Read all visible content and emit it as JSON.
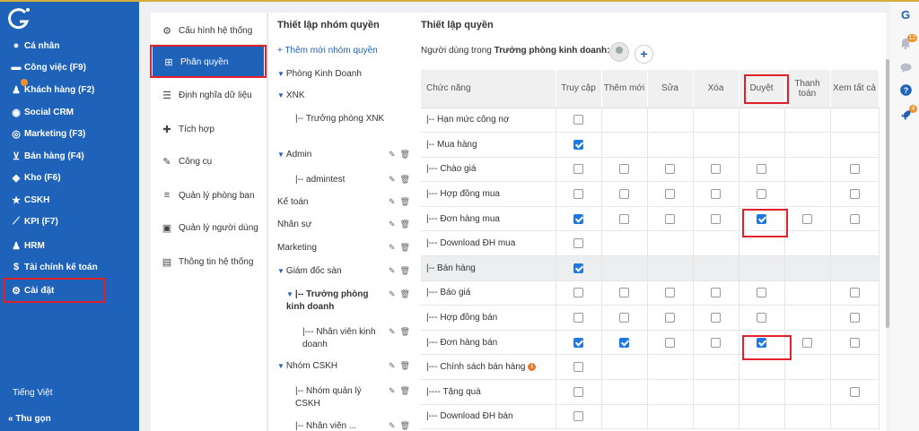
{
  "sidebar": {
    "logo": "G",
    "items": [
      {
        "icon": "user-icon",
        "label": "Cá nhân"
      },
      {
        "icon": "briefcase-icon",
        "label": "Công việc (F9)"
      },
      {
        "icon": "customers-icon",
        "label": "Khách hàng (F2)",
        "badge": true
      },
      {
        "icon": "eye-icon",
        "label": "Social CRM"
      },
      {
        "icon": "bullseye-icon",
        "label": "Marketing (F3)"
      },
      {
        "icon": "cart-icon",
        "label": "Bán hàng (F4)"
      },
      {
        "icon": "cubes-icon",
        "label": "Kho (F6)"
      },
      {
        "icon": "star-icon",
        "label": "CSKH"
      },
      {
        "icon": "chart-line-icon",
        "label": "KPI (F7)"
      },
      {
        "icon": "users-icon",
        "label": "HRM"
      },
      {
        "icon": "dollar-icon",
        "label": "Tài chính kế toán"
      },
      {
        "icon": "gear-icon",
        "label": "Cài đặt"
      }
    ],
    "language": "Tiếng Việt",
    "collapse": "Thu gọn"
  },
  "settings_menu": [
    {
      "icon": "cogs-icon",
      "label": "Cấu hình hệ thống"
    },
    {
      "icon": "sitemap-icon",
      "label": "Phân quyền",
      "active": true
    },
    {
      "icon": "list-icon",
      "label": "Định nghĩa dữ liệu"
    },
    {
      "icon": "puzzle-icon",
      "label": "Tích hợp"
    },
    {
      "icon": "wrench-icon",
      "label": "Công cụ"
    },
    {
      "icon": "sliders-icon",
      "label": "Quản lý phòng ban"
    },
    {
      "icon": "user-book-icon",
      "label": "Quản lý người dùng"
    },
    {
      "icon": "server-icon",
      "label": "Thông tin hệ thống"
    }
  ],
  "groups": {
    "title": "Thiết lập nhóm quyền",
    "add_label": "+ Thêm mới nhóm quyền",
    "items": [
      {
        "label": "Phòng Kinh Doanh",
        "tri": true,
        "actions": false
      },
      {
        "label": "XNK",
        "tri": true,
        "actions": false
      },
      {
        "label": "|-- Trưởng phòng XNK",
        "tri": false,
        "actions": false
      },
      {
        "label": "Admin",
        "tri": true,
        "actions": true
      },
      {
        "label": "|-- admintest",
        "tri": false,
        "actions": true
      },
      {
        "label": "Kế toán",
        "tri": false,
        "actions": true
      },
      {
        "label": "Nhân sự",
        "tri": false,
        "actions": true
      },
      {
        "label": "Marketing",
        "tri": false,
        "actions": true
      },
      {
        "label": "Giám đốc sàn",
        "tri": true,
        "actions": true
      },
      {
        "label": "|-- Trưởng phòng kinh doanh",
        "tri": true,
        "actions": true,
        "bold": true
      },
      {
        "label": "|--- Nhân viên kinh doanh",
        "tri": false,
        "actions": true
      },
      {
        "label": "Nhóm CSKH",
        "tri": true,
        "actions": true
      },
      {
        "label": "|-- Nhóm quản lý CSKH",
        "tri": false,
        "actions": true
      },
      {
        "label": "|-- Nhân viên ...",
        "tri": false,
        "actions": true
      }
    ]
  },
  "permissions": {
    "title": "Thiết lập quyền",
    "user_prefix": "Người dùng trong",
    "user_group": "Trưởng phòng kinh doanh:",
    "add_label": "+",
    "columns": [
      "Chức năng",
      "Truy cập",
      "Thêm mới",
      "Sửa",
      "Xóa",
      "Duyệt",
      "Thanh toán",
      "Xem tất cả"
    ],
    "rows": [
      {
        "name": "|-- Hạn mức công nợ",
        "sec": false,
        "cells": [
          "0",
          null,
          null,
          null,
          null,
          null,
          null
        ]
      },
      {
        "name": "|-- Mua hàng",
        "sec": false,
        "cells": [
          "1",
          null,
          null,
          null,
          null,
          null,
          null
        ]
      },
      {
        "name": "|--- Chào giá",
        "sec": false,
        "cells": [
          "0",
          "0",
          "0",
          "0",
          "0",
          null,
          "0"
        ]
      },
      {
        "name": "|--- Hợp đồng mua",
        "sec": false,
        "cells": [
          "0",
          "0",
          "0",
          "0",
          "0",
          null,
          "0"
        ]
      },
      {
        "name": "|--- Đơn hàng mua",
        "sec": false,
        "cells": [
          "1",
          "0",
          "0",
          "0",
          "1",
          "0",
          "0"
        ]
      },
      {
        "name": "|--- Download ĐH mua",
        "sec": false,
        "cells": [
          "0",
          null,
          null,
          null,
          null,
          null,
          null
        ]
      },
      {
        "name": "|-- Bán hàng",
        "sec": true,
        "cells": [
          "1",
          null,
          null,
          null,
          null,
          null,
          null
        ]
      },
      {
        "name": "|--- Báo giá",
        "sec": false,
        "cells": [
          "0",
          "0",
          "0",
          "0",
          "0",
          null,
          "0"
        ]
      },
      {
        "name": "|--- Hợp đồng bán",
        "sec": false,
        "cells": [
          "0",
          "0",
          "0",
          "0",
          "0",
          null,
          "0"
        ]
      },
      {
        "name": "|--- Đơn hàng bán",
        "sec": false,
        "cells": [
          "1",
          "1",
          "0",
          "0",
          "1",
          "0",
          "0"
        ]
      },
      {
        "name": "|--- Chính sách bán hàng",
        "sec": false,
        "info": true,
        "cells": [
          "0",
          null,
          null,
          null,
          null,
          null,
          null
        ]
      },
      {
        "name": "|---- Tặng quà",
        "sec": false,
        "cells": [
          "0",
          null,
          null,
          null,
          null,
          null,
          "0"
        ]
      },
      {
        "name": "|--- Download ĐH bán",
        "sec": false,
        "cells": [
          "0",
          null,
          null,
          null,
          null,
          null,
          null
        ]
      }
    ]
  },
  "rail": {
    "logo": "G",
    "notif_count": "12",
    "rocket_count": "4"
  },
  "colors": {
    "primary": "#1e62b9",
    "highlight": "#e0202a",
    "badge": "#f0902a",
    "check": "#1e7ae3"
  }
}
